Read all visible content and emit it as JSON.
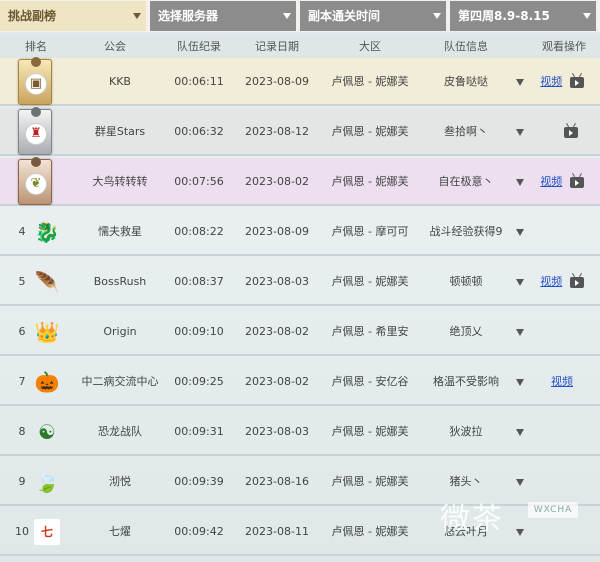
{
  "filters": [
    {
      "label": "挑战副榜"
    },
    {
      "label": "选择服务器"
    },
    {
      "label": "副本通关时间"
    },
    {
      "label": "第四周8.9-8.15"
    }
  ],
  "headers": {
    "rank": "排名",
    "guild": "公会",
    "record": "队伍纪录",
    "date": "记录日期",
    "region": "大区",
    "info": "队伍信息",
    "watch": "观看操作"
  },
  "rows": [
    {
      "rank": "",
      "medal": "gold",
      "logo_icon": "team-badge-icon",
      "guild": "KKB",
      "time": "00:06:11",
      "date": "2023-08-09",
      "region": "卢佩恩 - 妮娜芙",
      "info": "皮鲁哒哒",
      "video": "视频",
      "tv": true
    },
    {
      "rank": "",
      "medal": "silver",
      "logo_icon": "lion-icon",
      "guild": "群星Stars",
      "time": "00:06:32",
      "date": "2023-08-12",
      "region": "卢佩恩 - 妮娜芙",
      "info": "叁拾啊丶",
      "video": "",
      "tv": true
    },
    {
      "rank": "",
      "medal": "bronze",
      "logo_icon": "leaf-icon",
      "guild": "大鸟转转转",
      "time": "00:07:56",
      "date": "2023-08-02",
      "region": "卢佩恩 - 妮娜芙",
      "info": "自在极意丶",
      "video": "视频",
      "tv": true
    },
    {
      "rank": "4",
      "logo_icon": "dragon-icon",
      "logo_glyph": "🐉",
      "guild": "懦夫救星",
      "time": "00:08:22",
      "date": "2023-08-09",
      "region": "卢佩恩 - 摩可可",
      "info": "战斗经验获得9",
      "video": "",
      "tv": false
    },
    {
      "rank": "5",
      "logo_icon": "feather-icon",
      "logo_glyph": "🪶",
      "guild": "BossRush",
      "time": "00:08:37",
      "date": "2023-08-03",
      "region": "卢佩恩 - 妮娜芙",
      "info": "顿顿顿",
      "video": "视频",
      "tv": true
    },
    {
      "rank": "6",
      "logo_icon": "crown-icon",
      "logo_glyph": "👑",
      "guild": "Origin",
      "time": "00:09:10",
      "date": "2023-08-02",
      "region": "卢佩恩 - 希里安",
      "info": "绝顶乂",
      "video": "",
      "tv": false
    },
    {
      "rank": "7",
      "logo_icon": "pumpkin-icon",
      "logo_glyph": "🎃",
      "guild": "中二病交流中心",
      "time": "00:09:25",
      "date": "2023-08-02",
      "region": "卢佩恩 - 安亿谷",
      "info": "格温不受影响",
      "video": "视频",
      "tv": false
    },
    {
      "rank": "8",
      "logo_icon": "yin-yang-icon",
      "logo_glyph": "☯",
      "guild": "恐龙战队",
      "time": "00:09:31",
      "date": "2023-08-03",
      "region": "卢佩恩 - 妮娜芙",
      "info": "狄波拉",
      "video": "",
      "tv": false
    },
    {
      "rank": "9",
      "logo_icon": "leaf-icon",
      "logo_glyph": "🍃",
      "guild": "沏悦",
      "time": "00:09:39",
      "date": "2023-08-16",
      "region": "卢佩恩 - 妮娜芙",
      "info": "猪头丶",
      "video": "",
      "tv": false
    },
    {
      "rank": "10",
      "logo_icon": "qiyao-logo-icon",
      "logo_glyph": "七",
      "guild": "七燿",
      "time": "00:09:42",
      "date": "2023-08-11",
      "region": "卢佩恩 - 妮娜芙",
      "info": "悠云叶月",
      "video": "",
      "tv": false
    }
  ],
  "watermark": {
    "text": "微茶",
    "badge": "WXCHA"
  }
}
